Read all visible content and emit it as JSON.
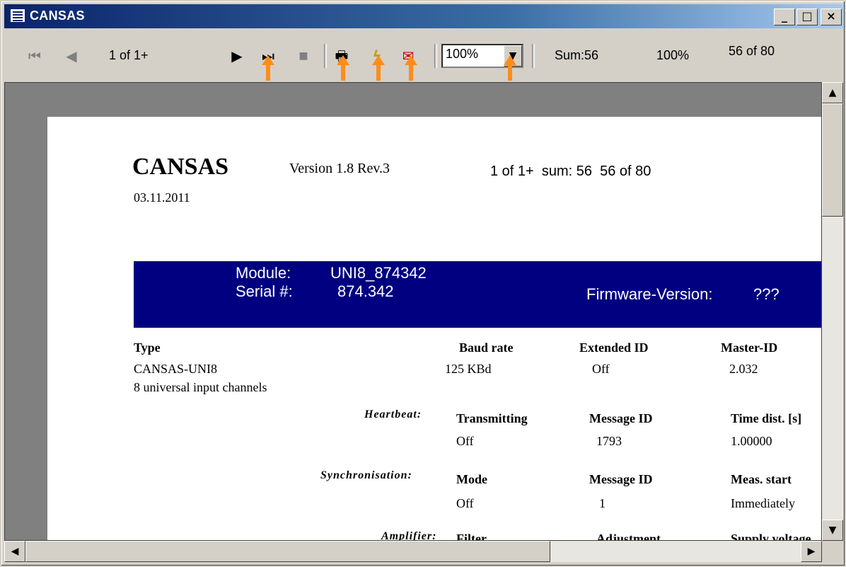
{
  "window": {
    "title": "CANSAS"
  },
  "title_buttons": {
    "minimize": "_",
    "maximize": "□",
    "close": "×"
  },
  "toolbar": {
    "page_indicator": "1 of 1+",
    "zoom_value": "100%",
    "sum": "Sum:56",
    "percent": "100%",
    "count": "56 of 80"
  },
  "callouts": [
    "1",
    "2",
    "3",
    "4",
    "5"
  ],
  "report": {
    "app_name": "CANSAS",
    "version": "Version 1.8 Rev.3",
    "date": "03.11.2011",
    "summary": "1 of 1+  sum: 56  56 of 80",
    "module_label": "Module:",
    "module_value": "UNI8_874342",
    "serial_label": "Serial #:",
    "serial_value": "874.342",
    "firmware_label": "Firmware-Version:",
    "firmware_value": "???",
    "type_header": "Type",
    "type_value": "CANSAS-UNI8",
    "type_desc": "8 universal input channels",
    "baud_header": "Baud rate",
    "baud_value": "125 KBd",
    "extid_header": "Extended ID",
    "extid_value": "Off",
    "master_header": "Master-ID",
    "master_value": "2.032",
    "heartbeat_label": "Heartbeat:",
    "hb_transmitting_header": "Transmitting",
    "hb_transmitting_value": "Off",
    "hb_msgid_header": "Message ID",
    "hb_msgid_value": "1793",
    "hb_time_header": "Time dist. [s]",
    "hb_time_value": "1.00000",
    "sync_label": "Synchronisation:",
    "sync_mode_header": "Mode",
    "sync_mode_value": "Off",
    "sync_msgid_header": "Message ID",
    "sync_msgid_value": "1",
    "sync_start_header": "Meas. start",
    "sync_start_value": "Immediately",
    "amp_label": "Amplifier:",
    "amp_filter_header": "Filter",
    "amp_adjust_header": "Adjustment",
    "amp_supply_header": "Supply voltage"
  },
  "colors": {
    "banner": "#000080",
    "callout_arrow": "#ff8c1a",
    "title_bar": "#0a246a"
  }
}
